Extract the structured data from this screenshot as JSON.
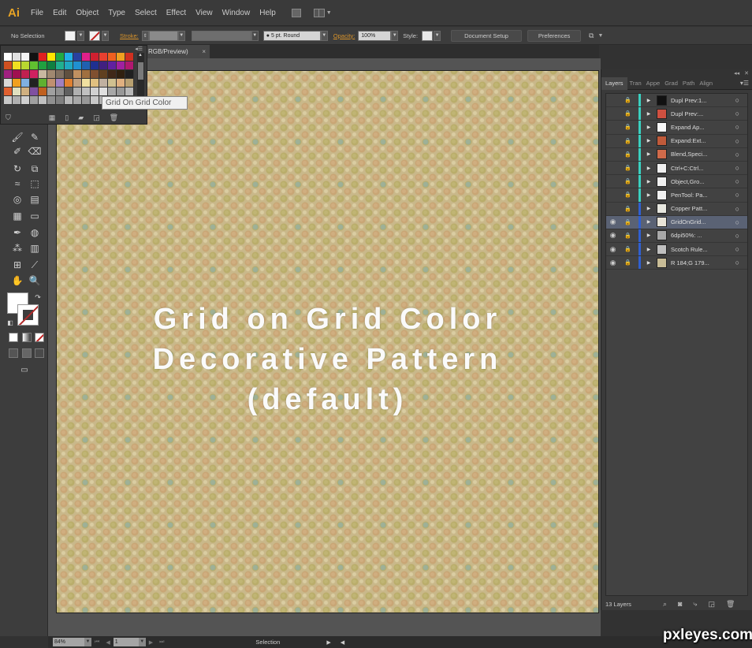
{
  "app": {
    "logo": "Ai"
  },
  "menu": [
    "File",
    "Edit",
    "Object",
    "Type",
    "Select",
    "Effect",
    "View",
    "Window",
    "Help"
  ],
  "control_bar": {
    "selection": "No Selection",
    "stroke_label": "Stroke:",
    "brush": "5 pt. Round",
    "opacity_label": "Opacity:",
    "opacity": "100%",
    "style_label": "Style:",
    "document_setup": "Document Setup",
    "preferences": "Preferences"
  },
  "document_tab": {
    "title": "RGB/Preview)",
    "close": "×"
  },
  "swatches": {
    "colors": [
      "#ffffff",
      "#e0e0e0",
      "#f5f5f5",
      "#111111",
      "#e02020",
      "#ffe500",
      "#22aa44",
      "#22b0e8",
      "#2840a0",
      "#e0208a",
      "#d02030",
      "#e84030",
      "#f06020",
      "#f0a020",
      "#d03020",
      "#d05020",
      "#f0e020",
      "#b8d830",
      "#60c030",
      "#20a040",
      "#108040",
      "#20b090",
      "#20a8c0",
      "#2090d0",
      "#2060b0",
      "#203090",
      "#402080",
      "#6020a0",
      "#a020a0",
      "#b01870",
      "#a02080",
      "#a01050",
      "#c02050",
      "#d02060",
      "#c8b8a0",
      "#a08870",
      "#807060",
      "#605040",
      "#c09060",
      "#a07040",
      "#805030",
      "#604020",
      "#402818",
      "#302010",
      "#202020",
      "#d8d8d8",
      "#f0a020",
      "#80b0e0",
      "#222222",
      "#60b030",
      "#c09070",
      "#a080c0",
      "#e08030",
      "#c0a080",
      "#f0e0a0",
      "#e0c080",
      "#c0b0a0",
      "#d0c090",
      "#e0b080",
      "#b8a070",
      "#e06030",
      "#e0e0c0",
      "#d0b080",
      "#8050a0",
      "#c06020",
      "#a0a0a0",
      "#909090",
      "#606060",
      "#b0b0b0",
      "#c0c0c0",
      "#d0d0d0",
      "#e0e0e0",
      "#a8a8a8",
      "#989898",
      "#b8b8b8",
      "#c8c8c8",
      "#b0b0b0",
      "#d0d0d0",
      "#a0a0a0",
      "#c0c0c0",
      "#909090",
      "#808080",
      "#b8b8b8",
      "#a8a8a8",
      "#989898",
      "#c8c8c8",
      "#b0b0b0",
      "#a0a0a0",
      "#d0d0d0",
      "#c0c0c0"
    ],
    "tooltip": "Grid On Grid Color"
  },
  "canvas": {
    "lines": [
      "Grid on Grid Color",
      "Decorative Pattern",
      "(default)"
    ]
  },
  "layers_panel": {
    "tabs": [
      "Layers",
      "Tran",
      "Appe",
      "Grad",
      "Path",
      "Align"
    ],
    "layers": [
      {
        "name": "Dupl Prev:1...",
        "visible": false,
        "color": "#3ad0c0",
        "thumb": "#111111",
        "selected": false
      },
      {
        "name": "Dupl Prev:...",
        "visible": false,
        "color": "#3ad0c0",
        "thumb": "#d05040",
        "selected": false
      },
      {
        "name": "Expand Ap...",
        "visible": false,
        "color": "#3ad0c0",
        "thumb": "#f8f8f8",
        "selected": false
      },
      {
        "name": "Expand:Ext...",
        "visible": false,
        "color": "#3ad0c0",
        "thumb": "#c05a3a",
        "selected": false
      },
      {
        "name": "Blend,Speci...",
        "visible": false,
        "color": "#3ad0c0",
        "thumb": "#d06a4a",
        "selected": false
      },
      {
        "name": "Ctrl+C:Ctrl...",
        "visible": false,
        "color": "#3ad0c0",
        "thumb": "#f0f0f0",
        "selected": false
      },
      {
        "name": "Object,Gro...",
        "visible": false,
        "color": "#3ad0c0",
        "thumb": "#f0f0f0",
        "selected": false
      },
      {
        "name": "PenTool: Pa...",
        "visible": false,
        "color": "#3ad0c0",
        "thumb": "#f0f0f0",
        "selected": false
      },
      {
        "name": "Copper Patt...",
        "visible": false,
        "color": "#3060d0",
        "thumb": "#e8e8e0",
        "selected": false
      },
      {
        "name": "GridOnGrid...",
        "visible": true,
        "color": "#3060d0",
        "thumb": "#e8e4d8",
        "selected": true
      },
      {
        "name": "6dpi50%: ...",
        "visible": true,
        "color": "#3060d0",
        "thumb": "#a8a8a8",
        "selected": false
      },
      {
        "name": "Scotch Rule...",
        "visible": true,
        "color": "#3060d0",
        "thumb": "#c0c0c0",
        "selected": false
      },
      {
        "name": "R 184;G 179...",
        "visible": true,
        "color": "#3060d0",
        "thumb": "#c8bc96",
        "selected": false
      }
    ],
    "layer_count": "13 Layers"
  },
  "status_bar": {
    "zoom": "84%",
    "page": "1",
    "status": "Selection"
  },
  "watermark": "pxleyes.com"
}
